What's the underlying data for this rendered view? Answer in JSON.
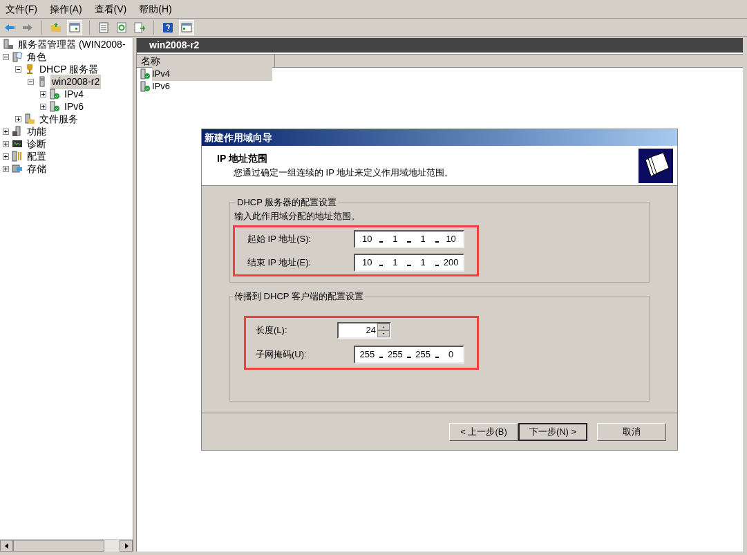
{
  "menu_bar": [
    "文件(F)",
    "操作(A)",
    "查看(V)",
    "帮助(H)"
  ],
  "toolbar": [
    {
      "kind": "back"
    },
    {
      "kind": "forward"
    },
    {
      "kind": "sep"
    },
    {
      "kind": "up"
    },
    {
      "kind": "pane",
      "selected": true
    },
    {
      "kind": "sep"
    },
    {
      "kind": "props"
    },
    {
      "kind": "refresh"
    },
    {
      "kind": "export"
    },
    {
      "kind": "sep"
    },
    {
      "kind": "help"
    },
    {
      "kind": "pane2",
      "selected": true
    }
  ],
  "tree": [
    {
      "label": "服务器管理器 (WIN2008-",
      "kind": "manager",
      "selected": false,
      "children": [
        {
          "label": "角色",
          "kind": "roles",
          "expanded": true,
          "selected": false,
          "children": [
            {
              "label": "DHCP 服务器",
              "kind": "dhcp",
              "expanded": true,
              "selected": false,
              "children": [
                {
                  "label": "win2008-r2",
                  "kind": "server",
                  "expanded": true,
                  "selected": true,
                  "children": [
                    {
                      "label": "IPv4",
                      "kind": "scope",
                      "expanded": false,
                      "selected": false
                    },
                    {
                      "label": "IPv6",
                      "kind": "scope",
                      "expanded": false,
                      "selected": false
                    }
                  ]
                }
              ]
            },
            {
              "label": "文件服务",
              "kind": "files",
              "expanded": false,
              "selected": false
            }
          ]
        },
        {
          "label": "功能",
          "kind": "features",
          "expanded": false,
          "selected": false
        },
        {
          "label": "诊断",
          "kind": "diag",
          "expanded": false,
          "selected": false
        },
        {
          "label": "配置",
          "kind": "config",
          "expanded": false,
          "selected": false
        },
        {
          "label": "存储",
          "kind": "storage",
          "expanded": false,
          "selected": false
        }
      ]
    }
  ],
  "content": {
    "title": "win2008-r2",
    "columns": [
      "名称"
    ],
    "rows": [
      {
        "name": "IPv4",
        "selected": true
      },
      {
        "name": "IPv6",
        "selected": false
      }
    ]
  },
  "dialog": {
    "title": "新建作用域向导",
    "heading": "IP 地址范围",
    "subheading": "您通过确定一组连续的 IP 地址来定义作用域地址范围。",
    "group1": {
      "legend": "DHCP 服务器的配置设置",
      "instruction": "输入此作用域分配的地址范围。",
      "fields": [
        {
          "label": "起始 IP 地址(S):",
          "octets": [
            "10",
            "1",
            "1",
            "10"
          ]
        },
        {
          "label": "结束 IP 地址(E):",
          "octets": [
            "10",
            "1",
            "1",
            "200"
          ]
        }
      ]
    },
    "group2": {
      "legend": "传播到 DHCP 客户端的配置设置",
      "length_label": "长度(L):",
      "length": "24",
      "mask_label": "子网掩码(U):",
      "mask": [
        "255",
        "255",
        "255",
        "0"
      ]
    },
    "buttons": [
      {
        "label": "< 上一步(B)",
        "default": false
      },
      {
        "label": "下一步(N) >",
        "default": true
      },
      {
        "label": "取消",
        "default": false
      }
    ]
  }
}
